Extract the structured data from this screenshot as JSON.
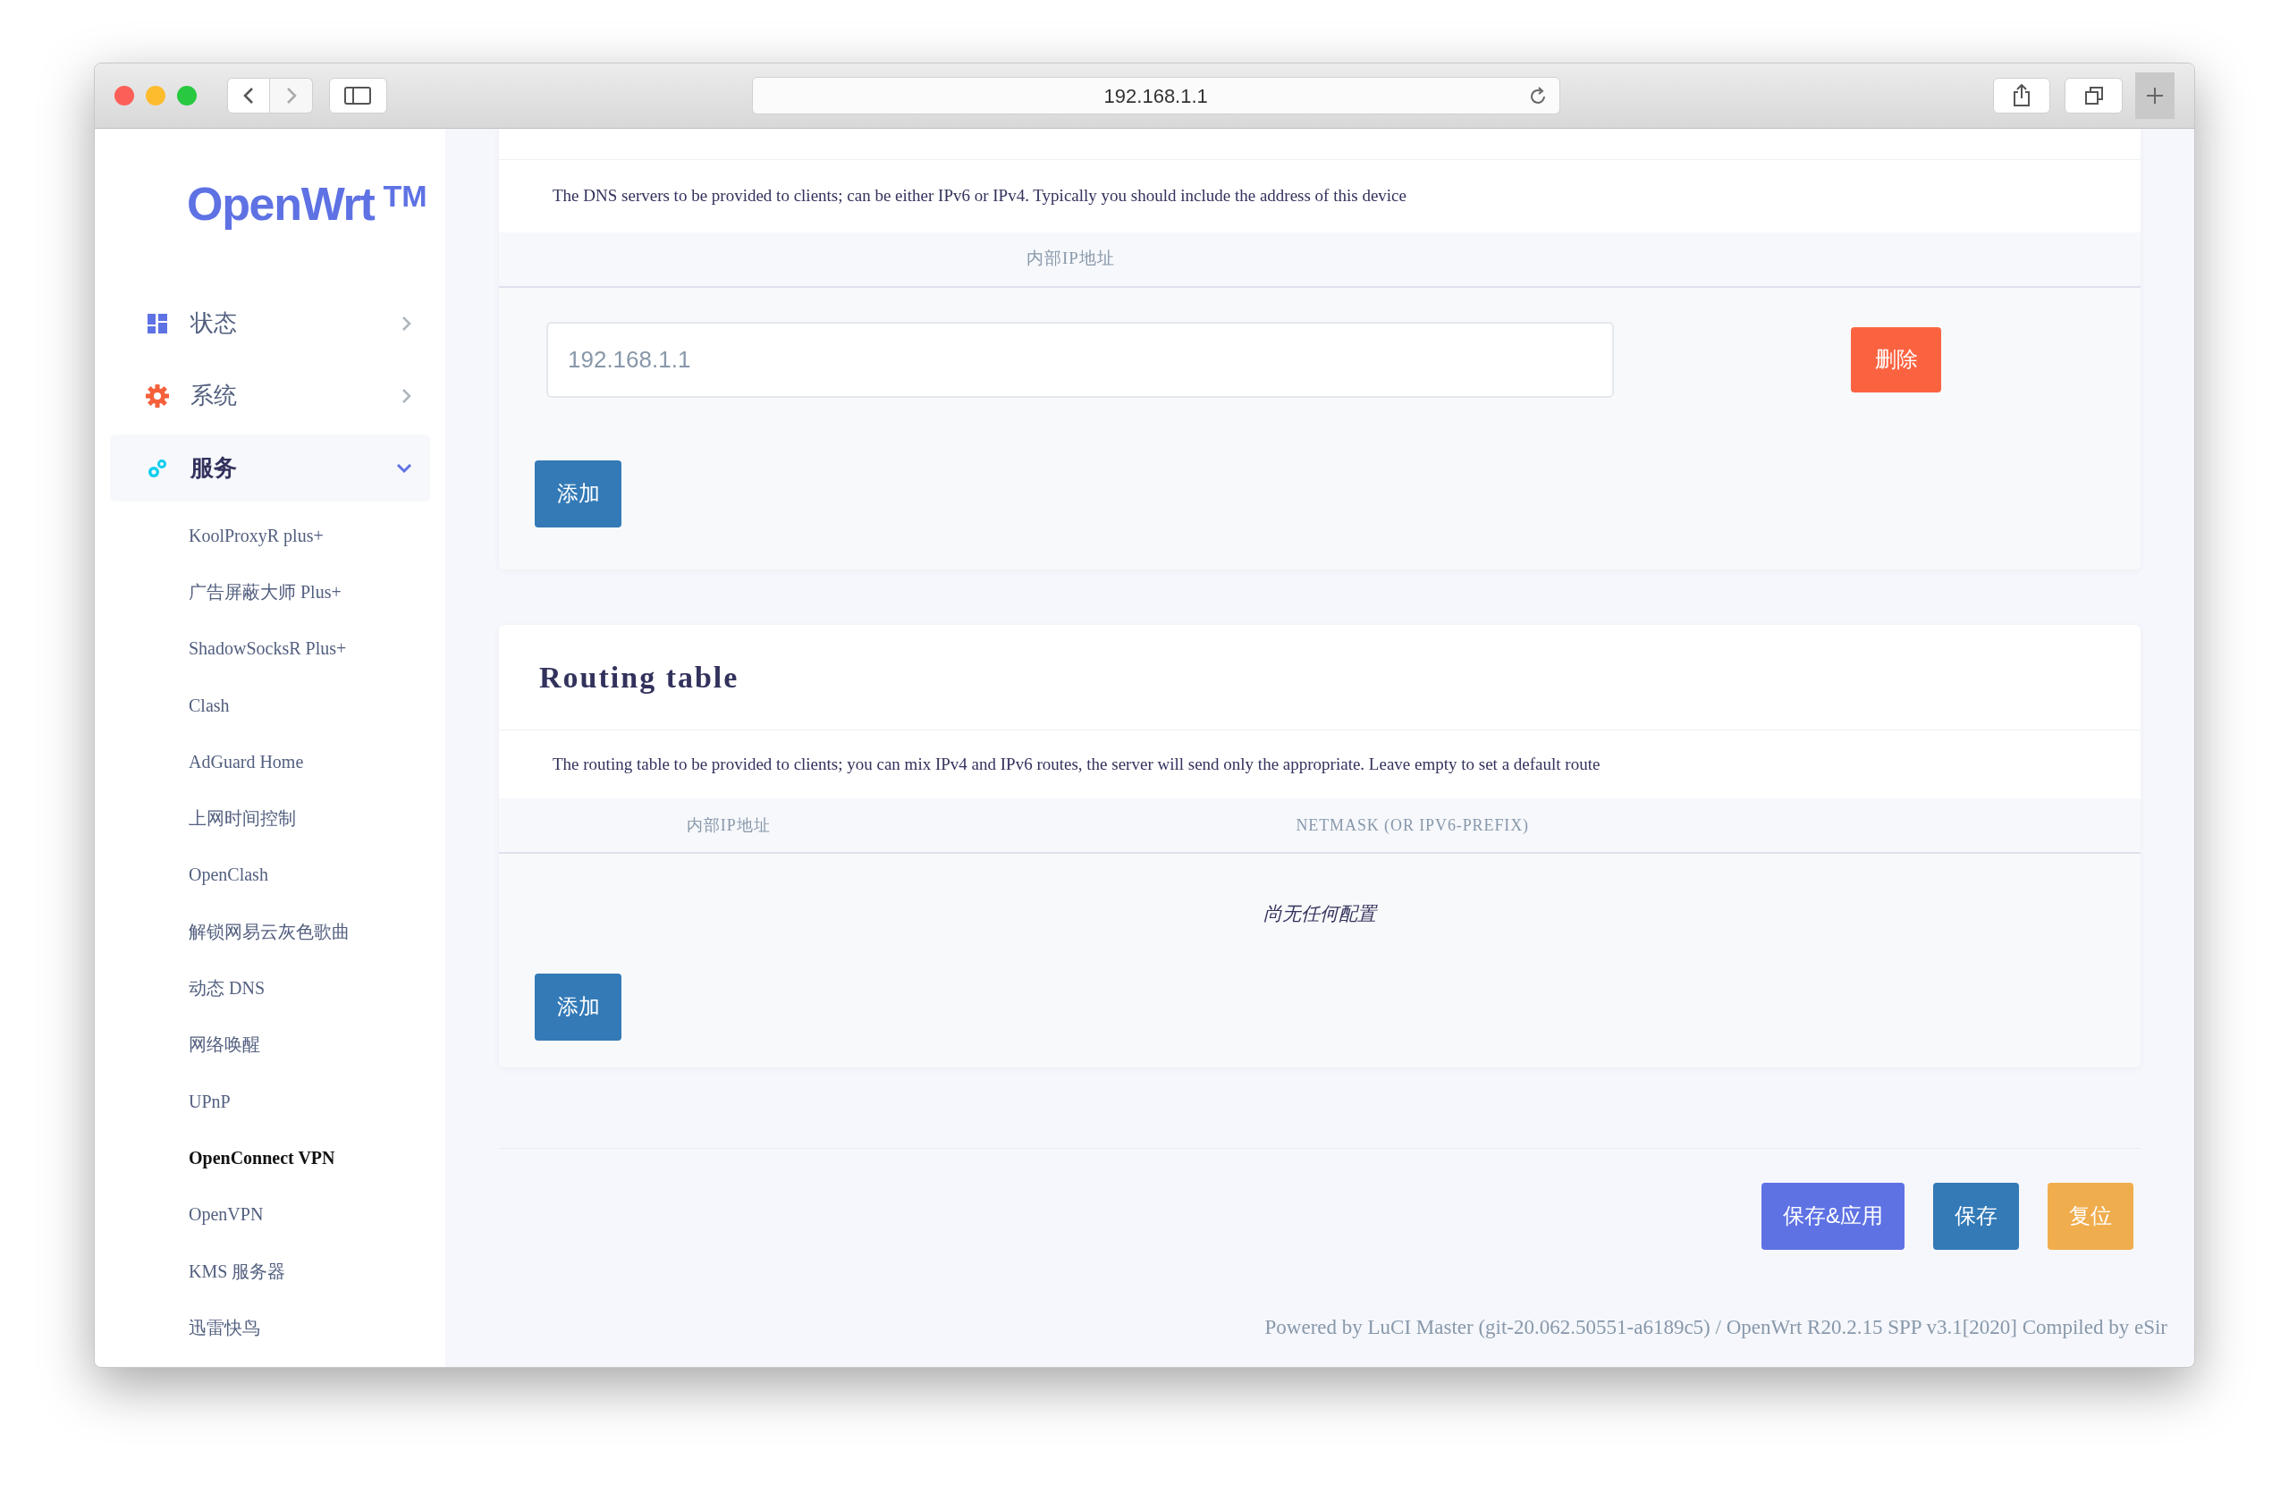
{
  "browser": {
    "url": "192.168.1.1"
  },
  "sidebar": {
    "logo": "OpenWrt",
    "logo_mark": "TM",
    "menu": [
      {
        "label": "状态",
        "expanded": false
      },
      {
        "label": "系统",
        "expanded": false
      },
      {
        "label": "服务",
        "expanded": true
      }
    ],
    "submenu": [
      {
        "label": "KoolProxyR plus+",
        "selected": false
      },
      {
        "label": "广告屏蔽大师 Plus+",
        "selected": false
      },
      {
        "label": "ShadowSocksR Plus+",
        "selected": false
      },
      {
        "label": "Clash",
        "selected": false
      },
      {
        "label": "AdGuard Home",
        "selected": false
      },
      {
        "label": "上网时间控制",
        "selected": false
      },
      {
        "label": "OpenClash",
        "selected": false
      },
      {
        "label": "解锁网易云灰色歌曲",
        "selected": false
      },
      {
        "label": "动态 DNS",
        "selected": false
      },
      {
        "label": "网络唤醒",
        "selected": false
      },
      {
        "label": "UPnP",
        "selected": false
      },
      {
        "label": "OpenConnect VPN",
        "selected": true
      },
      {
        "label": "OpenVPN",
        "selected": false
      },
      {
        "label": "KMS 服务器",
        "selected": false
      },
      {
        "label": "迅雷快鸟",
        "selected": false
      }
    ]
  },
  "dns_section": {
    "description": "The DNS servers to be provided to clients; can be either IPv6 or IPv4. Typically you should include the address of this device",
    "column": "内部IP地址",
    "rows": [
      {
        "value": "192.168.1.1",
        "delete_label": "删除"
      }
    ],
    "add_label": "添加"
  },
  "routing_section": {
    "title": "Routing table",
    "description": "The routing table to be provided to clients; you can mix IPv4 and IPv6 routes, the server will send only the appropriate. Leave empty to set a default route",
    "columns": [
      "内部IP地址",
      "NETMASK (OR IPV6-PREFIX)"
    ],
    "empty_text": "尚无任何配置",
    "add_label": "添加"
  },
  "actions": [
    {
      "label": "保存&应用",
      "kind": "apply"
    },
    {
      "label": "保存",
      "kind": "save"
    },
    {
      "label": "复位",
      "kind": "reset"
    }
  ],
  "footer": "Powered by LuCI Master (git-20.062.50551-a6189c5) / OpenWrt R20.2.15 SPP v3.1[2020] Compiled by eSir"
}
